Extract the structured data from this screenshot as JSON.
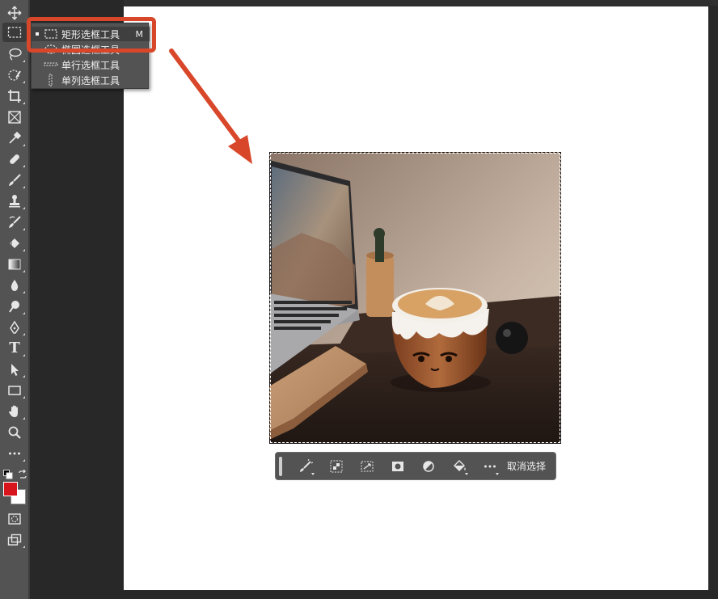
{
  "colors": {
    "foreground": "#d8141c",
    "background": "#ffffff",
    "accent": "#d9472b"
  },
  "toolbar": {
    "tools": [
      {
        "name": "move-tool",
        "icon": "move-icon"
      },
      {
        "name": "rectangular-marquee-tool",
        "icon": "marquee-rect-icon",
        "active": true
      },
      {
        "name": "lasso-tool",
        "icon": "lasso-icon"
      },
      {
        "name": "quick-selection-tool",
        "icon": "quick-selection-icon"
      },
      {
        "name": "crop-tool",
        "icon": "crop-icon"
      },
      {
        "name": "frame-tool",
        "icon": "frame-icon"
      },
      {
        "name": "eyedropper-tool",
        "icon": "eyedropper-icon"
      },
      {
        "name": "spot-healing-tool",
        "icon": "bandage-icon"
      },
      {
        "name": "brush-tool",
        "icon": "brush-icon"
      },
      {
        "name": "clone-stamp-tool",
        "icon": "stamp-icon"
      },
      {
        "name": "history-brush-tool",
        "icon": "history-brush-icon"
      },
      {
        "name": "eraser-tool",
        "icon": "eraser-icon"
      },
      {
        "name": "gradient-tool",
        "icon": "gradient-icon"
      },
      {
        "name": "blur-tool",
        "icon": "droplet-icon"
      },
      {
        "name": "dodge-tool",
        "icon": "dodge-icon"
      },
      {
        "name": "pen-tool",
        "icon": "pen-icon"
      },
      {
        "name": "type-tool",
        "icon": "type-icon"
      },
      {
        "name": "path-selection-tool",
        "icon": "arrow-icon"
      },
      {
        "name": "rectangle-tool",
        "icon": "rectangle-icon"
      },
      {
        "name": "hand-tool",
        "icon": "hand-icon"
      },
      {
        "name": "zoom-tool",
        "icon": "zoom-icon"
      },
      {
        "name": "more-tools",
        "icon": "more-icon"
      }
    ],
    "type_glyph": "T"
  },
  "flyout": {
    "items": [
      {
        "label": "矩形选框工具",
        "shortcut": "M",
        "selected": true
      },
      {
        "label": "椭圆选框工具",
        "shortcut": "",
        "selected": false
      },
      {
        "label": "单行选框工具",
        "shortcut": "",
        "selected": false
      },
      {
        "label": "单列选框工具",
        "shortcut": "",
        "selected": false
      }
    ]
  },
  "context_bar": {
    "buttons": [
      {
        "name": "select-subject-icon"
      },
      {
        "name": "select-mask-icon"
      },
      {
        "name": "transform-selection-icon"
      },
      {
        "name": "mask-icon"
      },
      {
        "name": "adjustment-icon"
      },
      {
        "name": "fill-icon"
      },
      {
        "name": "more-icon"
      }
    ],
    "deselect_label": "取消选择"
  }
}
